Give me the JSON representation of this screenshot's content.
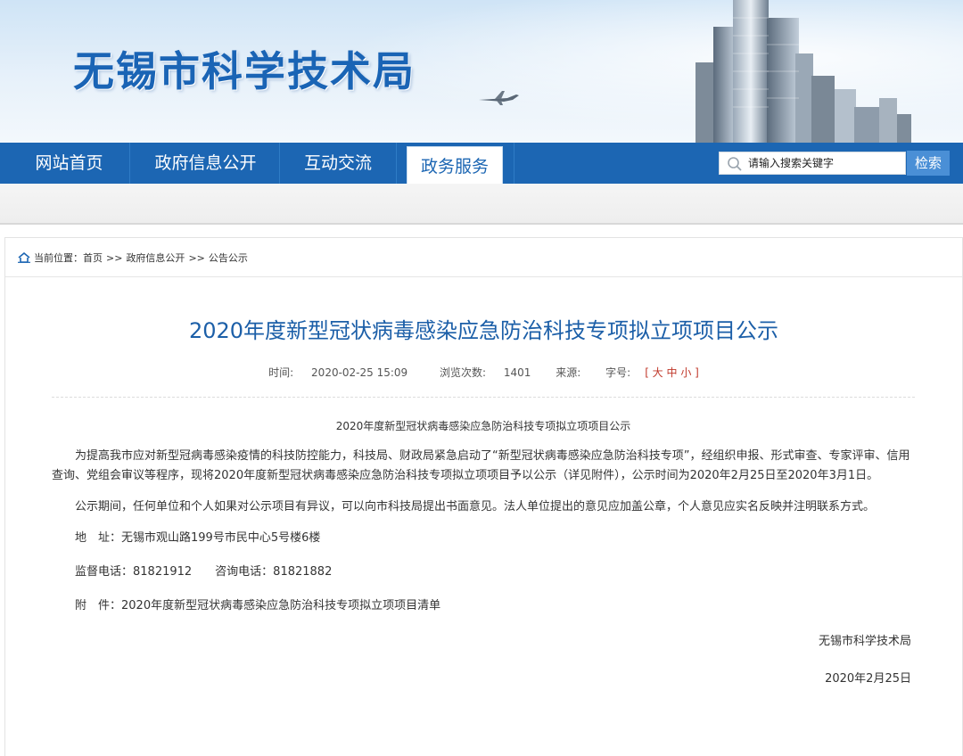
{
  "site": {
    "title": "无锡市科学技术局"
  },
  "nav": {
    "items": [
      "网站首页",
      "政府信息公开",
      "互动交流",
      "政务服务"
    ],
    "active_index": 3
  },
  "search": {
    "placeholder": "请输入搜索关键字",
    "button": "检索"
  },
  "breadcrumb": {
    "prefix": "当前位置：",
    "items": [
      "首页",
      "政府信息公开",
      "公告公示"
    ],
    "separator": ">>"
  },
  "article": {
    "title": "2020年度新型冠状病毒感染应急防治科技专项拟立项项目公示",
    "meta": {
      "time_label": "时间:",
      "time": "2020-02-25 15:09",
      "views_label": "浏览次数:",
      "views": "1401",
      "source_label": "来源:",
      "font_label": "字号:",
      "font_sizes": "[ 大 中 小 ]"
    },
    "subtitle": "2020年度新型冠状病毒感染应急防治科技专项拟立项项目公示",
    "para1": "为提高我市应对新型冠病毒感染疫情的科技防控能力，科技局、财政局紧急启动了“新型冠状病毒感染应急防治科技专项”，经组织申报、形式审查、专家评审、信用查询、党组会审议等程序，现将2020年度新型冠状病毒感染应急防治科技专项拟立项项目予以公示（详见附件），公示时间为2020年2月25日至2020年3月1日。",
    "para2": "公示期间，任何单位和个人如果对公示项目有异议，可以向市科技局提出书面意见。法人单位提出的意见应加盖公章，个人意见应实名反映并注明联系方式。",
    "address": "地　址：无锡市观山路199号市民中心5号楼6楼",
    "phones": "监督电话：81821912　　咨询电话：81821882",
    "attachment_label": "附　件：",
    "attachment": "2020年度新型冠状病毒感染应急防治科技专项拟立项项目清单",
    "signature": "无锡市科学技术局",
    "date": "2020年2月25日"
  },
  "colors": {
    "nav_bg": "#1c66b3",
    "title_blue": "#1c5fa8",
    "search_btn": "#4a8fd6"
  }
}
